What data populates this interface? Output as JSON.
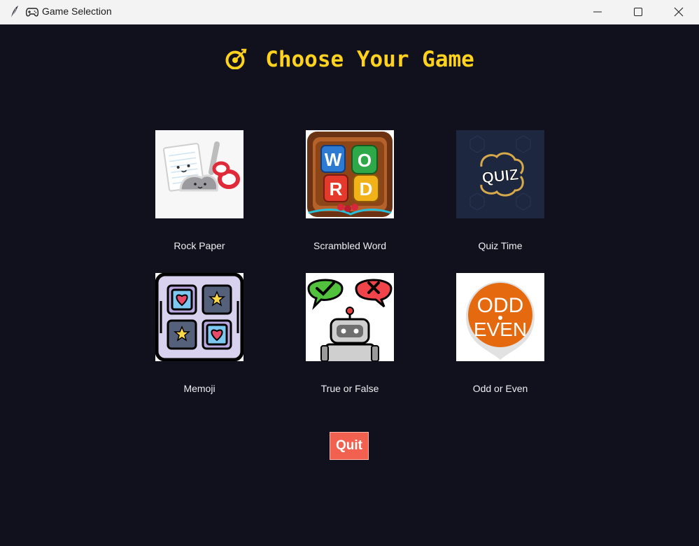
{
  "window": {
    "title": "Game Selection",
    "app_icon": "feather-icon",
    "title_icon": "gamepad-icon",
    "controls": [
      "minimize-icon",
      "maximize-icon",
      "close-icon"
    ]
  },
  "main": {
    "heading": "Choose Your Game",
    "heading_icon": "target-icon",
    "heading_color": "#ffd21e",
    "background_color": "#11111e"
  },
  "games": [
    {
      "label": "Rock Paper",
      "icon": "rock-paper-scissors-icon"
    },
    {
      "label": "Scrambled Word",
      "icon": "word-blocks-icon",
      "image_text": "WORD"
    },
    {
      "label": "Quiz Time",
      "icon": "quiz-brain-icon",
      "image_text": "QUIZ"
    },
    {
      "label": "Memoji",
      "icon": "memory-cards-icon"
    },
    {
      "label": "True or False",
      "icon": "robot-true-false-icon"
    },
    {
      "label": "Odd or Even",
      "icon": "odd-even-icon",
      "image_text": [
        "ODD",
        "EVEN"
      ]
    }
  ],
  "quit": {
    "label": "Quit",
    "color": "#f2604f"
  }
}
